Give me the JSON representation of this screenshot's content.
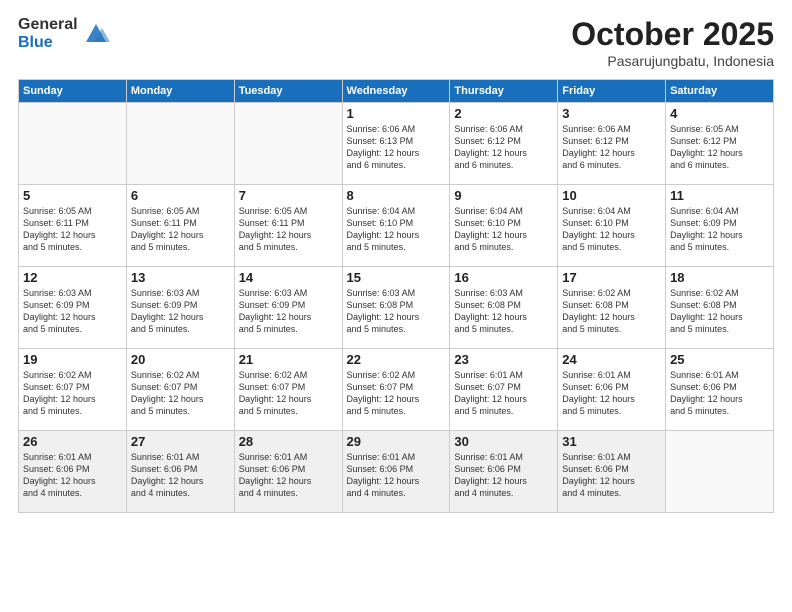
{
  "header": {
    "logo_general": "General",
    "logo_blue": "Blue",
    "month_title": "October 2025",
    "subtitle": "Pasarujungbatu, Indonesia"
  },
  "weekdays": [
    "Sunday",
    "Monday",
    "Tuesday",
    "Wednesday",
    "Thursday",
    "Friday",
    "Saturday"
  ],
  "weeks": [
    [
      {
        "day": "",
        "info": ""
      },
      {
        "day": "",
        "info": ""
      },
      {
        "day": "",
        "info": ""
      },
      {
        "day": "1",
        "info": "Sunrise: 6:06 AM\nSunset: 6:13 PM\nDaylight: 12 hours\nand 6 minutes."
      },
      {
        "day": "2",
        "info": "Sunrise: 6:06 AM\nSunset: 6:12 PM\nDaylight: 12 hours\nand 6 minutes."
      },
      {
        "day": "3",
        "info": "Sunrise: 6:06 AM\nSunset: 6:12 PM\nDaylight: 12 hours\nand 6 minutes."
      },
      {
        "day": "4",
        "info": "Sunrise: 6:05 AM\nSunset: 6:12 PM\nDaylight: 12 hours\nand 6 minutes."
      }
    ],
    [
      {
        "day": "5",
        "info": "Sunrise: 6:05 AM\nSunset: 6:11 PM\nDaylight: 12 hours\nand 5 minutes."
      },
      {
        "day": "6",
        "info": "Sunrise: 6:05 AM\nSunset: 6:11 PM\nDaylight: 12 hours\nand 5 minutes."
      },
      {
        "day": "7",
        "info": "Sunrise: 6:05 AM\nSunset: 6:11 PM\nDaylight: 12 hours\nand 5 minutes."
      },
      {
        "day": "8",
        "info": "Sunrise: 6:04 AM\nSunset: 6:10 PM\nDaylight: 12 hours\nand 5 minutes."
      },
      {
        "day": "9",
        "info": "Sunrise: 6:04 AM\nSunset: 6:10 PM\nDaylight: 12 hours\nand 5 minutes."
      },
      {
        "day": "10",
        "info": "Sunrise: 6:04 AM\nSunset: 6:10 PM\nDaylight: 12 hours\nand 5 minutes."
      },
      {
        "day": "11",
        "info": "Sunrise: 6:04 AM\nSunset: 6:09 PM\nDaylight: 12 hours\nand 5 minutes."
      }
    ],
    [
      {
        "day": "12",
        "info": "Sunrise: 6:03 AM\nSunset: 6:09 PM\nDaylight: 12 hours\nand 5 minutes."
      },
      {
        "day": "13",
        "info": "Sunrise: 6:03 AM\nSunset: 6:09 PM\nDaylight: 12 hours\nand 5 minutes."
      },
      {
        "day": "14",
        "info": "Sunrise: 6:03 AM\nSunset: 6:09 PM\nDaylight: 12 hours\nand 5 minutes."
      },
      {
        "day": "15",
        "info": "Sunrise: 6:03 AM\nSunset: 6:08 PM\nDaylight: 12 hours\nand 5 minutes."
      },
      {
        "day": "16",
        "info": "Sunrise: 6:03 AM\nSunset: 6:08 PM\nDaylight: 12 hours\nand 5 minutes."
      },
      {
        "day": "17",
        "info": "Sunrise: 6:02 AM\nSunset: 6:08 PM\nDaylight: 12 hours\nand 5 minutes."
      },
      {
        "day": "18",
        "info": "Sunrise: 6:02 AM\nSunset: 6:08 PM\nDaylight: 12 hours\nand 5 minutes."
      }
    ],
    [
      {
        "day": "19",
        "info": "Sunrise: 6:02 AM\nSunset: 6:07 PM\nDaylight: 12 hours\nand 5 minutes."
      },
      {
        "day": "20",
        "info": "Sunrise: 6:02 AM\nSunset: 6:07 PM\nDaylight: 12 hours\nand 5 minutes."
      },
      {
        "day": "21",
        "info": "Sunrise: 6:02 AM\nSunset: 6:07 PM\nDaylight: 12 hours\nand 5 minutes."
      },
      {
        "day": "22",
        "info": "Sunrise: 6:02 AM\nSunset: 6:07 PM\nDaylight: 12 hours\nand 5 minutes."
      },
      {
        "day": "23",
        "info": "Sunrise: 6:01 AM\nSunset: 6:07 PM\nDaylight: 12 hours\nand 5 minutes."
      },
      {
        "day": "24",
        "info": "Sunrise: 6:01 AM\nSunset: 6:06 PM\nDaylight: 12 hours\nand 5 minutes."
      },
      {
        "day": "25",
        "info": "Sunrise: 6:01 AM\nSunset: 6:06 PM\nDaylight: 12 hours\nand 5 minutes."
      }
    ],
    [
      {
        "day": "26",
        "info": "Sunrise: 6:01 AM\nSunset: 6:06 PM\nDaylight: 12 hours\nand 4 minutes."
      },
      {
        "day": "27",
        "info": "Sunrise: 6:01 AM\nSunset: 6:06 PM\nDaylight: 12 hours\nand 4 minutes."
      },
      {
        "day": "28",
        "info": "Sunrise: 6:01 AM\nSunset: 6:06 PM\nDaylight: 12 hours\nand 4 minutes."
      },
      {
        "day": "29",
        "info": "Sunrise: 6:01 AM\nSunset: 6:06 PM\nDaylight: 12 hours\nand 4 minutes."
      },
      {
        "day": "30",
        "info": "Sunrise: 6:01 AM\nSunset: 6:06 PM\nDaylight: 12 hours\nand 4 minutes."
      },
      {
        "day": "31",
        "info": "Sunrise: 6:01 AM\nSunset: 6:06 PM\nDaylight: 12 hours\nand 4 minutes."
      },
      {
        "day": "",
        "info": ""
      }
    ]
  ]
}
